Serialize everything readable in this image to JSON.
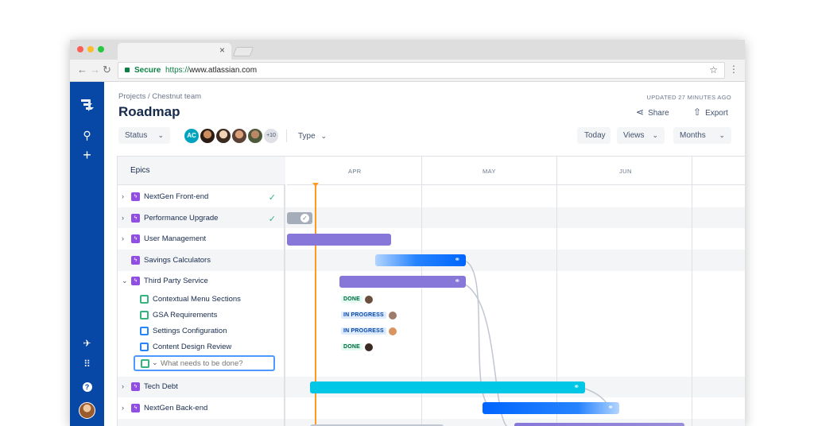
{
  "browser": {
    "tab_close": "×",
    "secure_label": "Secure",
    "url_scheme": "https://",
    "url_host": "www.atlassian.com"
  },
  "header": {
    "breadcrumb": "Projects / Chestnut team",
    "title": "Roadmap",
    "updated": "UPDATED 27 MINUTES AGO",
    "share_label": "Share",
    "export_label": "Export"
  },
  "toolbar": {
    "status_label": "Status",
    "assignee_initials": "AC",
    "more_count": "+10",
    "type_label": "Type",
    "today_label": "Today",
    "views_label": "Views",
    "months_label": "Months"
  },
  "timeline": {
    "epics_header": "Epics",
    "months": [
      "APR",
      "MAY",
      "JUN"
    ],
    "epics": [
      {
        "label": "NextGen Front-end",
        "done": true
      },
      {
        "label": "Performance Upgrade",
        "done": true
      },
      {
        "label": "User Management",
        "done": false
      },
      {
        "label": "Savings Calculators",
        "done": false
      },
      {
        "label": "Third Party Service",
        "done": false
      },
      {
        "label": "Tech Debt",
        "done": false
      },
      {
        "label": "NextGen Back-end",
        "done": false
      }
    ],
    "subtasks": [
      {
        "label": "Contextual Menu Sections",
        "status": "DONE"
      },
      {
        "label": "GSA Requirements",
        "status": "IN PROGRESS"
      },
      {
        "label": "Settings Configuration",
        "status": "IN PROGRESS"
      },
      {
        "label": "Content Design Review",
        "status": "DONE"
      }
    ],
    "new_task_placeholder": "What needs to be done?"
  },
  "colors": {
    "sidebar": "#0747a6",
    "epic": "#904ee2",
    "done": "#36b37e",
    "in_progress": "#0052cc",
    "today": "#ff991f"
  }
}
